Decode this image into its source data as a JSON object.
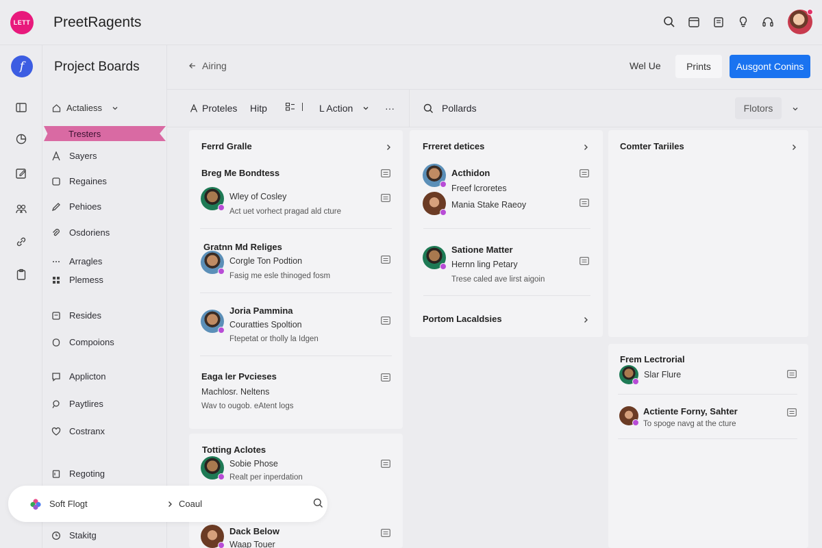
{
  "header": {
    "logo_text": "LETT",
    "app_title": "PreetRagents",
    "icons": [
      "search-icon",
      "calendar-icon",
      "clipboard-icon",
      "bulb-icon",
      "headset-icon"
    ]
  },
  "rail": {
    "brand_glyph": "𝑓",
    "icons": [
      "board-icon",
      "chart-icon",
      "edit-icon",
      "people-icon",
      "link-icon",
      "clipboard-icon"
    ]
  },
  "sidebar": {
    "title": "Project Boards",
    "section": "Actaliess",
    "active_item": "Tresters",
    "items": [
      {
        "label": "Sayers",
        "icon": "letter-a-icon"
      },
      {
        "label": "Regaines",
        "icon": "square-icon"
      },
      {
        "label": "Pehioes",
        "icon": "pencil-icon"
      },
      {
        "label": "Osdoriens",
        "icon": "paperclip-icon"
      },
      {
        "label": "Arragles",
        "icon": "dots-icon"
      },
      {
        "label": "Plemess",
        "icon": "grid-icon"
      },
      {
        "label": "Resides",
        "icon": "note-icon"
      },
      {
        "label": "Compoions",
        "icon": "circle-icon"
      },
      {
        "label": "Applicton",
        "icon": "chat-icon"
      },
      {
        "label": "Paytlires",
        "icon": "pin-icon"
      },
      {
        "label": "Costranx",
        "icon": "heart-icon"
      },
      {
        "label": "Regoting",
        "icon": "flag-icon"
      },
      {
        "label": "Stakitg",
        "icon": "clock-icon"
      }
    ]
  },
  "toolbar": {
    "breadcrumb": "Airing",
    "link_text": "Wel Ue",
    "prints_label": "Prints",
    "primary_label": "Ausgont Conins",
    "proteles": "Proteles",
    "hitp": "Hitp",
    "action": "L Action",
    "more": "···",
    "search_value": "Pollards",
    "filter_label": "Flotors"
  },
  "columns": [
    {
      "title": "Ferrd Gralle",
      "tasks": [
        {
          "title": "Breg Me Bondtess",
          "sub": "",
          "desc": ""
        },
        {
          "title": "",
          "sub": "Wley of Cosley",
          "desc": "Act uet vorhect pragad ald cture"
        },
        {
          "title": "Gratnn Md Religes",
          "sub": "Corgle Ton Podtion",
          "desc": "Fasig me esle thinoged fosm"
        },
        {
          "title": "Joria Pammina",
          "sub": "Couratties Spoltion",
          "desc": "Ftepetat or tholly la Idgen"
        },
        {
          "title": "Eaga ler Pvcieses",
          "sub": "Machlosr. Neltens",
          "desc": "Wav to ougob. eAtent logs"
        },
        {
          "title": "Totting Aclotes",
          "sub": "Sobie Phose",
          "desc": "Realt per inperdation"
        },
        {
          "title": "Dack Below",
          "sub": "Waap Touer",
          "desc": ""
        }
      ]
    },
    {
      "title": "Frreret detices",
      "tasks": [
        {
          "title": "Acthidon",
          "sub": "Freef lcroretes",
          "desc": ""
        },
        {
          "title": "",
          "sub": "Mania Stake Raeoy",
          "desc": ""
        },
        {
          "title": "Satione Matter",
          "sub": "Hernn ling Petary",
          "desc": "Trese caled ave lirst aigoin"
        },
        {
          "title": "Portom Lacaldsies",
          "sub": "",
          "desc": ""
        }
      ]
    },
    {
      "title": "Comter Tariiles",
      "tasks": []
    },
    {
      "title": "Frem Lectrorial",
      "tasks": [
        {
          "title": "",
          "sub": "Slar Flure",
          "desc": ""
        },
        {
          "title": "Actiente Forny, Sahter",
          "sub": "",
          "desc": "To spoge navg at the cture"
        }
      ]
    }
  ],
  "floater": {
    "label": "Soft Flogt",
    "crumb": "Coaul"
  }
}
